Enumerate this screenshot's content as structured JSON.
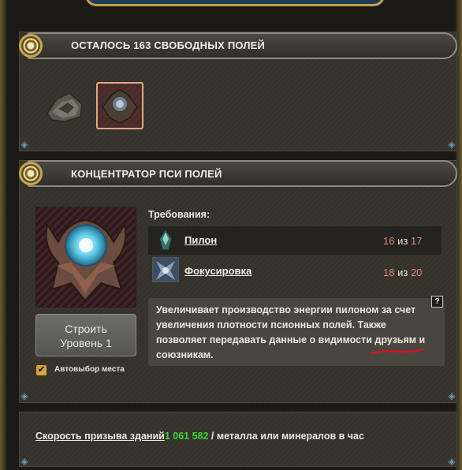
{
  "fields_panel": {
    "title": "ОСТАЛОСЬ 163 СВОБОДНЫХ ПОЛЕЙ",
    "slots": [
      {
        "icon": "pylon-building-icon",
        "selected": false
      },
      {
        "icon": "psi-field-concentrator-icon",
        "selected": true
      }
    ]
  },
  "building_panel": {
    "title": "КОНЦЕНТРАТОР ПСИ ПОЛЕЙ",
    "image_icon": "psi-field-concentrator-icon",
    "build_button": {
      "line1": "Строить",
      "line2": "Уровень 1"
    },
    "auto_select": {
      "label": "Автовыбор места",
      "checked": true,
      "check_glyph": "✔"
    },
    "requirements_label": "Требования:",
    "requirements": [
      {
        "name": "Пилон",
        "have": "16",
        "sep": "из",
        "need": "17",
        "icon": "pylon-icon"
      },
      {
        "name": "Фокусировка",
        "have": "18",
        "sep": "из",
        "need": "20",
        "icon": "focusing-icon"
      }
    ],
    "help_glyph": "?",
    "description": "Увеличивает производство энергии пилоном за счет увеличения плотности псионных полей. Также позволяет передавать данные о видимости друзьям и союзникам."
  },
  "summon_panel": {
    "label": "Скорость призыва зданий",
    "value": "1 061 582",
    "suffix": " / металла или минералов в час",
    "value_color": "#39d43a"
  },
  "colors": {
    "accent_gold": "#c8a64e",
    "requirement_count": "#e08a78",
    "underline_annotation": "#d6121a"
  }
}
